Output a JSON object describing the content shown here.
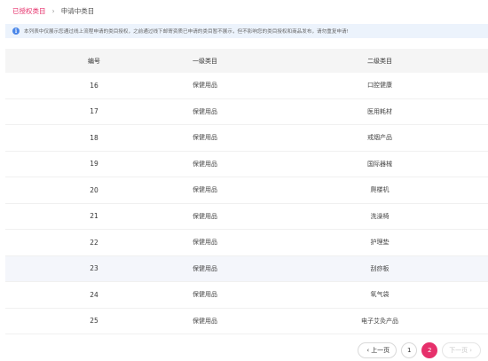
{
  "breadcrumb": {
    "active": "已授权类目",
    "separator": "›",
    "current": "申请中类目"
  },
  "notice": {
    "icon": "info-icon",
    "text": "本列表中仅展示您通过线上流程申请的类目授权，之前通过线下邮寄资质已申请的类目暂不展示，但不影响您的类目授权和商品发布，请勿重复申请!"
  },
  "table": {
    "headers": [
      "编号",
      "一级类目",
      "二级类目"
    ],
    "rows": [
      {
        "id": "16",
        "cat1": "保健用品",
        "cat2": "口腔健康"
      },
      {
        "id": "17",
        "cat1": "保健用品",
        "cat2": "医用耗材"
      },
      {
        "id": "18",
        "cat1": "保健用品",
        "cat2": "戒烟产品"
      },
      {
        "id": "19",
        "cat1": "保健用品",
        "cat2": "国际器械"
      },
      {
        "id": "20",
        "cat1": "保健用品",
        "cat2": "爬楼机"
      },
      {
        "id": "21",
        "cat1": "保健用品",
        "cat2": "洗澡椅"
      },
      {
        "id": "22",
        "cat1": "保健用品",
        "cat2": "护理垫"
      },
      {
        "id": "23",
        "cat1": "保健用品",
        "cat2": "刮痧板"
      },
      {
        "id": "24",
        "cat1": "保健用品",
        "cat2": "氧气袋"
      },
      {
        "id": "25",
        "cat1": "保健用品",
        "cat2": "电子艾灸产品"
      }
    ]
  },
  "pagination": {
    "prev_label": "上一页",
    "next_label": "下一页",
    "pages": [
      "1",
      "2"
    ],
    "current_page": "2"
  },
  "colors": {
    "accent": "#e6306b",
    "notice_bg": "#ecf3fc",
    "header_bg": "#f5f5f5"
  }
}
